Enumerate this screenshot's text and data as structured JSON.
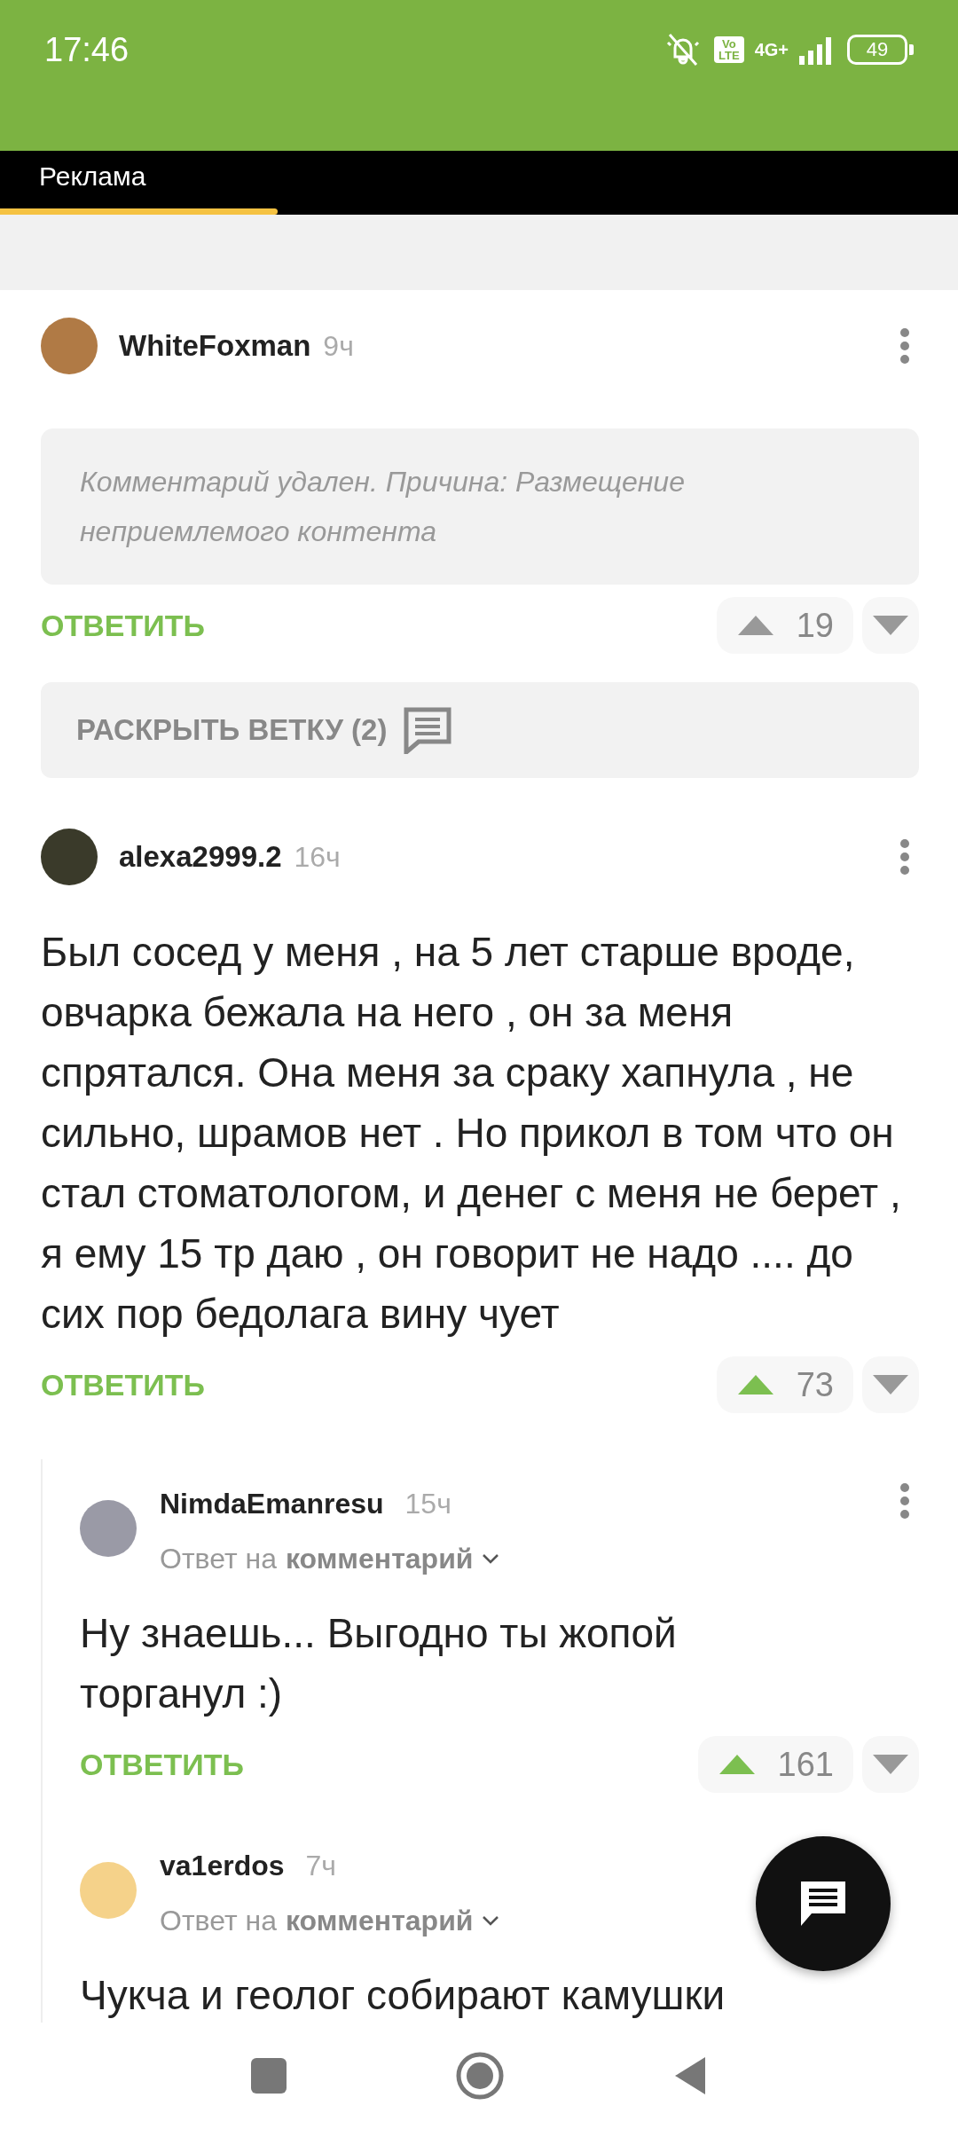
{
  "status_bar": {
    "time": "17:46",
    "volte": [
      "Vo",
      "LTE"
    ],
    "network": "4G+",
    "battery": "49"
  },
  "ad": {
    "label": "Реклама",
    "level": 0.29
  },
  "comments": [
    {
      "kind": "deleted",
      "author": "WhiteFoxman",
      "time": "9ч",
      "text": "Комментарий удален. Причина: Размещение неприемлемого контента",
      "reply": "ОТВЕТИТЬ",
      "rating": "19",
      "upvoted": false,
      "expand": "РАСКРЫТЬ ВЕТКУ (2)"
    },
    {
      "kind": "normal",
      "author": "alexa2999.2",
      "time": "16ч",
      "text": "Был сосед у меня , на 5 лет старше вроде, овчарка бежала на него , он за меня спрятался. Она меня за сраку хапнула , не сильно, шрамов нет . Но прикол в том что он стал стоматологом, и денег с меня не берет , я ему 15 тр даю , он говорит не надо .... до сих пор бедолага вину чует",
      "reply": "ОТВЕТИТЬ",
      "rating": "73",
      "upvoted": true,
      "children": [
        {
          "kind": "normal",
          "author": "NimdaEmanresu",
          "time": "15ч",
          "reply_to": {
            "prefix": "Ответ на",
            "link": "комментарий"
          },
          "text": "Ну знаешь... Выгодно ты жопой торганул :)",
          "reply": "ОТВЕТИТЬ",
          "rating": "161",
          "upvoted": true
        },
        {
          "kind": "normal",
          "author": "va1erdos",
          "time": "7ч",
          "reply_to": {
            "prefix": "Ответ на",
            "link": "комментарий"
          },
          "text": "Чукча и геолог собирают камушки"
        }
      ]
    }
  ]
}
